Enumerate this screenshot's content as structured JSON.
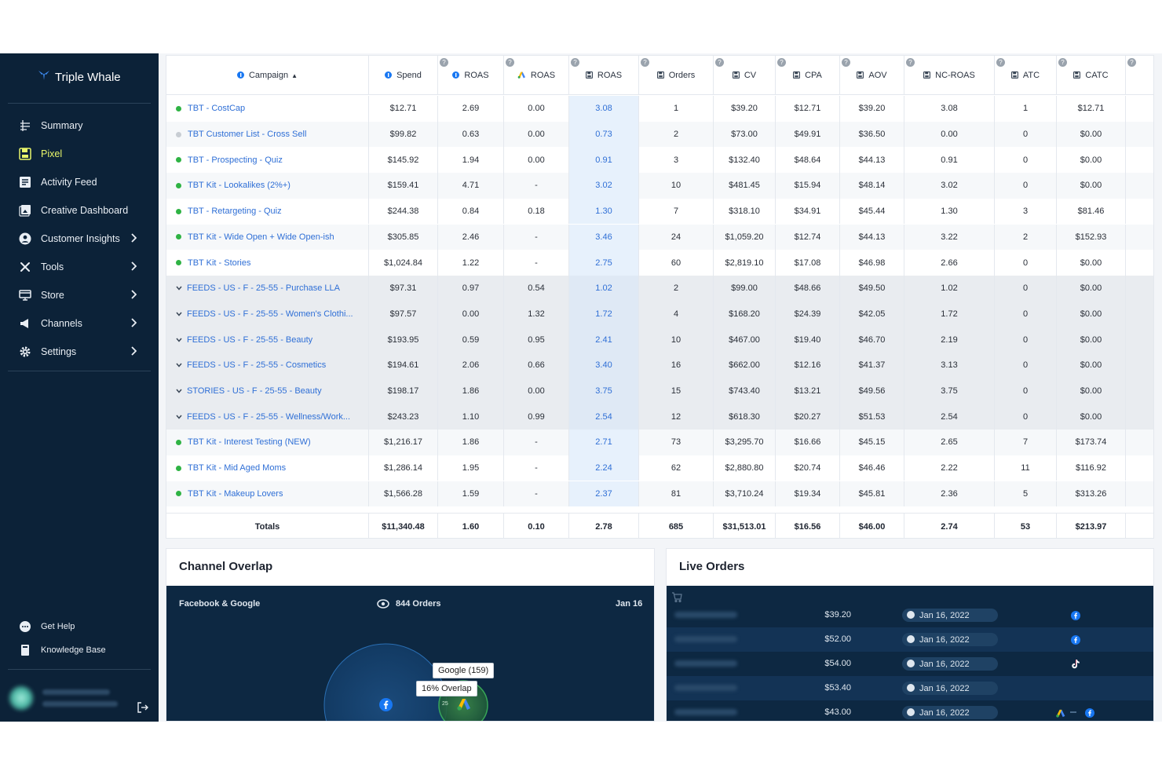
{
  "brand": {
    "name": "Triple Whale"
  },
  "sidebar": {
    "items": [
      {
        "label": "Summary",
        "icon": "summary-icon",
        "active": false,
        "chevron": false
      },
      {
        "label": "Pixel",
        "icon": "pixel-icon",
        "active": true,
        "chevron": false
      },
      {
        "label": "Activity Feed",
        "icon": "activity-feed-icon",
        "active": false,
        "chevron": false
      },
      {
        "label": "Creative Dashboard",
        "icon": "creative-dashboard-icon",
        "active": false,
        "chevron": false
      },
      {
        "label": "Customer Insights",
        "icon": "customer-insights-icon",
        "active": false,
        "chevron": true
      },
      {
        "label": "Tools",
        "icon": "tools-icon",
        "active": false,
        "chevron": true
      },
      {
        "label": "Store",
        "icon": "store-icon",
        "active": false,
        "chevron": true
      },
      {
        "label": "Channels",
        "icon": "megaphone-icon",
        "active": false,
        "chevron": true
      },
      {
        "label": "Settings",
        "icon": "gear-icon",
        "active": false,
        "chevron": true
      }
    ],
    "help": "Get Help",
    "knowledge_base": "Knowledge Base"
  },
  "table": {
    "columns": [
      "Campaign",
      "Spend",
      "ROAS",
      "ROAS",
      "ROAS",
      "Orders",
      "CV",
      "CPA",
      "AOV",
      "NC-ROAS",
      "ATC",
      "CATC"
    ],
    "sort_indicator": "▲",
    "rows": [
      {
        "campaign": "TBT - CostCap",
        "status": "active",
        "group": false,
        "values": [
          "$12.71",
          "2.69",
          "0.00",
          "3.08",
          "1",
          "$39.20",
          "$12.71",
          "$39.20",
          "3.08",
          "1",
          "$12.71"
        ]
      },
      {
        "campaign": "TBT Customer List - Cross Sell",
        "status": "inactive",
        "group": false,
        "values": [
          "$99.82",
          "0.63",
          "0.00",
          "0.73",
          "2",
          "$73.00",
          "$49.91",
          "$36.50",
          "0.00",
          "0",
          "$0.00"
        ]
      },
      {
        "campaign": "TBT - Prospecting - Quiz",
        "status": "active",
        "group": false,
        "values": [
          "$145.92",
          "1.94",
          "0.00",
          "0.91",
          "3",
          "$132.40",
          "$48.64",
          "$44.13",
          "0.91",
          "0",
          "$0.00"
        ]
      },
      {
        "campaign": "TBT Kit - Lookalikes (2%+)",
        "status": "active",
        "group": false,
        "values": [
          "$159.41",
          "4.71",
          "-",
          "3.02",
          "10",
          "$481.45",
          "$15.94",
          "$48.14",
          "3.02",
          "0",
          "$0.00"
        ]
      },
      {
        "campaign": "TBT - Retargeting - Quiz",
        "status": "active",
        "group": false,
        "values": [
          "$244.38",
          "0.84",
          "0.18",
          "1.30",
          "7",
          "$318.10",
          "$34.91",
          "$45.44",
          "1.30",
          "3",
          "$81.46"
        ]
      },
      {
        "campaign": "TBT Kit - Wide Open + Wide Open-ish",
        "status": "active",
        "group": false,
        "values": [
          "$305.85",
          "2.46",
          "-",
          "3.46",
          "24",
          "$1,059.20",
          "$12.74",
          "$44.13",
          "3.22",
          "2",
          "$152.93"
        ]
      },
      {
        "campaign": "TBT Kit - Stories",
        "status": "active",
        "group": false,
        "values": [
          "$1,024.84",
          "1.22",
          "-",
          "2.75",
          "60",
          "$2,819.10",
          "$17.08",
          "$46.98",
          "2.66",
          "0",
          "$0.00"
        ]
      },
      {
        "campaign": "FEEDS - US - F - 25-55 - Purchase LLA",
        "status": "group",
        "group": true,
        "values": [
          "$97.31",
          "0.97",
          "0.54",
          "1.02",
          "2",
          "$99.00",
          "$48.66",
          "$49.50",
          "1.02",
          "0",
          "$0.00"
        ]
      },
      {
        "campaign": "FEEDS - US - F - 25-55 - Women's Clothi...",
        "status": "group",
        "group": true,
        "values": [
          "$97.57",
          "0.00",
          "1.32",
          "1.72",
          "4",
          "$168.20",
          "$24.39",
          "$42.05",
          "1.72",
          "0",
          "$0.00"
        ]
      },
      {
        "campaign": "FEEDS - US - F - 25-55 - Beauty",
        "status": "group",
        "group": true,
        "values": [
          "$193.95",
          "0.59",
          "0.95",
          "2.41",
          "10",
          "$467.00",
          "$19.40",
          "$46.70",
          "2.19",
          "0",
          "$0.00"
        ]
      },
      {
        "campaign": "FEEDS - US - F - 25-55 - Cosmetics",
        "status": "group",
        "group": true,
        "values": [
          "$194.61",
          "2.06",
          "0.66",
          "3.40",
          "16",
          "$662.00",
          "$12.16",
          "$41.37",
          "3.13",
          "0",
          "$0.00"
        ]
      },
      {
        "campaign": "STORIES - US - F - 25-55 - Beauty",
        "status": "group",
        "group": true,
        "values": [
          "$198.17",
          "1.86",
          "0.00",
          "3.75",
          "15",
          "$743.40",
          "$13.21",
          "$49.56",
          "3.75",
          "0",
          "$0.00"
        ]
      },
      {
        "campaign": "FEEDS - US - F - 25-55 - Wellness/Work...",
        "status": "group",
        "group": true,
        "values": [
          "$243.23",
          "1.10",
          "0.99",
          "2.54",
          "12",
          "$618.30",
          "$20.27",
          "$51.53",
          "2.54",
          "0",
          "$0.00"
        ]
      },
      {
        "campaign": "TBT Kit - Interest Testing (NEW)",
        "status": "active",
        "group": false,
        "values": [
          "$1,216.17",
          "1.86",
          "-",
          "2.71",
          "73",
          "$3,295.70",
          "$16.66",
          "$45.15",
          "2.65",
          "7",
          "$173.74"
        ]
      },
      {
        "campaign": "TBT Kit - Mid Aged Moms",
        "status": "active",
        "group": false,
        "values": [
          "$1,286.14",
          "1.95",
          "-",
          "2.24",
          "62",
          "$2,880.80",
          "$20.74",
          "$46.46",
          "2.22",
          "11",
          "$116.92"
        ]
      },
      {
        "campaign": "TBT Kit - Makeup Lovers",
        "status": "active",
        "group": false,
        "values": [
          "$1,566.28",
          "1.59",
          "-",
          "2.37",
          "81",
          "$3,710.24",
          "$19.34",
          "$45.81",
          "2.36",
          "5",
          "$313.26"
        ]
      }
    ],
    "totals": {
      "label": "Totals",
      "values": [
        "$11,340.48",
        "1.60",
        "0.10",
        "2.78",
        "685",
        "$31,513.01",
        "$16.56",
        "$46.00",
        "2.74",
        "53",
        "$213.97"
      ]
    }
  },
  "overlap": {
    "title": "Channel Overlap",
    "channels": "Facebook & Google",
    "orders": "844 Orders",
    "date": "Jan 16",
    "tooltip_google": "Google (159)",
    "tooltip_overlap": "16% Overlap",
    "small_count": "25"
  },
  "live": {
    "title": "Live Orders",
    "orders": [
      {
        "amount": "$39.20",
        "date": "Jan 16, 2022",
        "source": "facebook"
      },
      {
        "amount": "$52.00",
        "date": "Jan 16, 2022",
        "source": "facebook"
      },
      {
        "amount": "$54.00",
        "date": "Jan 16, 2022",
        "source": "tiktok"
      },
      {
        "amount": "$53.40",
        "date": "Jan 16, 2022",
        "source": "none"
      },
      {
        "amount": "$43.00",
        "date": "Jan 16, 2022",
        "source": "google-facebook"
      }
    ]
  },
  "colors": {
    "sidebar_bg": "#0c2238",
    "active_nav": "#e8f56a",
    "link_blue": "#2f6fd6",
    "status_green": "#2fb344",
    "panel_dark": "#0d2842"
  }
}
